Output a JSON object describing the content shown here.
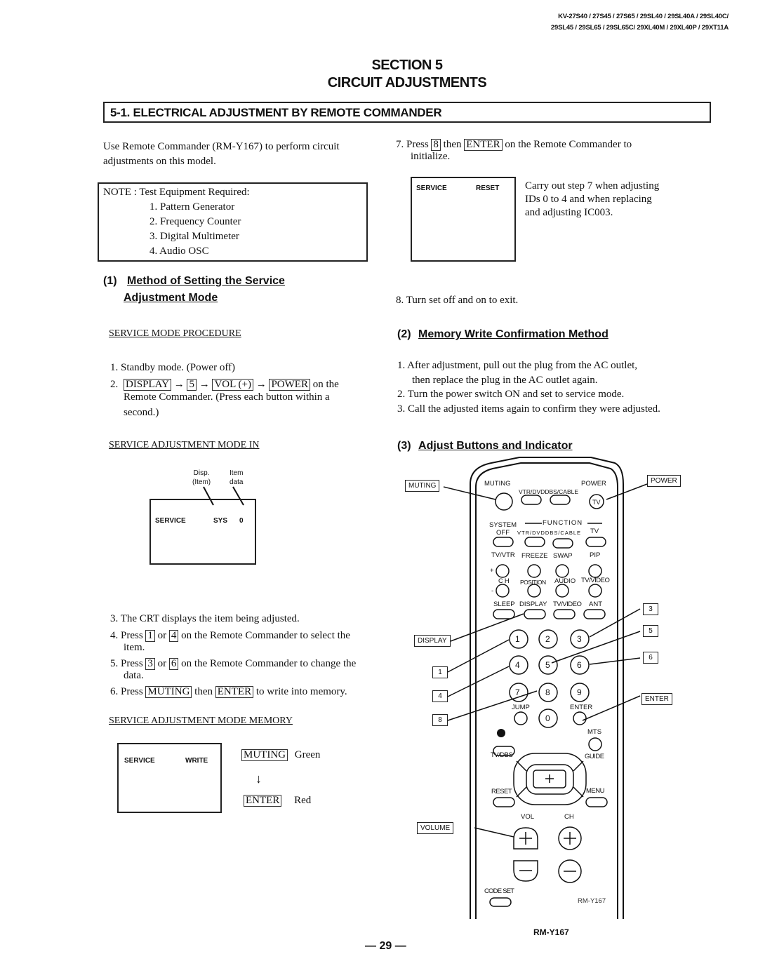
{
  "header": {
    "models_line1": "KV-27S40 / 27S45 / 27S65 / 29SL40 / 29SL40A / 29SL40C/",
    "models_line2": "29SL45 / 29SL65 / 29SL65C/ 29XL40M / 29XL40P / 29XT11A",
    "section": "SECTION 5",
    "section_title": "CIRCUIT ADJUSTMENTS",
    "subsection": "5-1.  ELECTRICAL ADJUSTMENT BY REMOTE COMMANDER"
  },
  "intro": {
    "line1": "Use Remote Commander (RM-Y167) to perform circuit",
    "line2": "adjustments on this model."
  },
  "note": {
    "title": "NOTE : Test Equipment Required:",
    "items": [
      "1.  Pattern Generator",
      "2.  Frequency Counter",
      "3.  Digital Multimeter",
      "4.  Audio OSC"
    ]
  },
  "method": {
    "num": "(1)",
    "title_line1": "Method of Setting the Service",
    "title_line2": "Adjustment Mode",
    "procedure_heading": "SERVICE MODE PROCEDURE",
    "step1": "1.  Standby mode. (Power off)",
    "step2_num": "2.",
    "step2_keys": [
      "DISPLAY",
      "5",
      "VOL (+)",
      "POWER"
    ],
    "arrow": "→",
    "step2_tail": "on the",
    "step2_line2": "Remote Commander. (Press each button within a",
    "step2_line3": "second.)",
    "mode_in_heading": "SERVICE  ADJUSTMENT MODE IN",
    "callout_disp_line1": "Disp.",
    "callout_disp_line2": "(Item)",
    "callout_item_line1": "Item",
    "callout_item_line2": "data",
    "screen_in": {
      "left": "SERVICE",
      "item": "SYS",
      "value": "0"
    },
    "step3": "3.  The CRT displays the item being adjusted.",
    "step4": {
      "pre": "4.  Press",
      "k1": "1",
      "mid": "or",
      "k2": "4",
      "post": "on the Remote Commander to select the",
      "line2": "item."
    },
    "step5": {
      "pre": "5.  Press",
      "k1": "3",
      "mid": "or",
      "k2": "6",
      "post": "on the Remote Commander to change the",
      "line2": "data."
    },
    "step6": {
      "pre": "6.  Press",
      "k1": "MUTING",
      "mid": "then",
      "k2": "ENTER",
      "post": "to write into memory."
    },
    "memory_heading": "SERVICE  ADJUSTMENT MODE MEMORY",
    "screen_write": {
      "left": "SERVICE",
      "right": "WRITE"
    },
    "indicator": {
      "key1": "MUTING",
      "color1": "Green",
      "down_arrow": "↓",
      "key2": "ENTER",
      "color2": "Red"
    }
  },
  "right": {
    "step7": {
      "pre": "7.  Press",
      "k1": "8",
      "mid": "then",
      "k2": "ENTER",
      "post": "on the Remote Commander to",
      "line2": "initialize."
    },
    "screen_reset": {
      "left": "SERVICE",
      "right": "RESET"
    },
    "reset_note": [
      "Carry out step 7 when adjusting",
      "IDs 0 to 4 and when replacing",
      "and adjusting IC003."
    ],
    "step8": "8. Turn set off and on to exit.",
    "memory_num": "(2)",
    "memory_title": "Memory Write Confirmation Method",
    "memory_steps": [
      "1.   After adjustment, pull out the plug from the AC outlet,",
      "then replace the plug in the AC outlet again.",
      "2.  Turn the power switch ON and set to service mode.",
      "3.  Call the adjusted items again to confirm they were adjusted."
    ],
    "adjust_num": "(3)",
    "adjust_title": "Adjust Buttons and Indicator"
  },
  "remote": {
    "model_caption": "RM-Y167",
    "model_on_remote": "RM-Y167",
    "callouts": {
      "muting": "MUTING",
      "power": "POWER",
      "display": "DISPLAY",
      "k1": "1",
      "k4": "4",
      "k8": "8",
      "k3": "3",
      "k5": "5",
      "k6": "6",
      "enter": "ENTER",
      "volume": "VOLUME"
    },
    "labels": {
      "muting": "MUTING",
      "power": "POWER",
      "vtr_dvd": "VTR/DVD",
      "dbs_cable": "DBS/CABLE",
      "tv": "TV",
      "system": "SYSTEM",
      "off": "OFF",
      "function": "FUNCTION",
      "fn_vtr": "VTR/DVD",
      "fn_dbs": "DBS/CABLE",
      "fn_tv": "TV",
      "tvvtr": "TV/VTR",
      "freeze": "FREEZE",
      "swap": "SWAP",
      "pip": "PIP",
      "plus": "+",
      "minus": "-",
      "ch": "CH",
      "position": "POSITION",
      "audio": "AUDIO",
      "tvvideo1": "TV/VIDEO",
      "sleep": "SLEEP",
      "display": "DISPLAY",
      "tvvideo2": "TV/VIDEO",
      "ant": "ANT",
      "jump": "JUMP",
      "enter": "ENTER",
      "mts": "MTS",
      "tvdbs": "TV/DBS",
      "guide": "GUIDE",
      "reset": "RESET",
      "menu": "MENU",
      "vol": "VOL",
      "ch2": "CH",
      "code_set": "CODE SET",
      "note_icon": "♪"
    },
    "digits": [
      "1",
      "2",
      "3",
      "4",
      "5",
      "6",
      "7",
      "8",
      "9",
      "0"
    ]
  },
  "footer": {
    "page": "— 29 —"
  }
}
